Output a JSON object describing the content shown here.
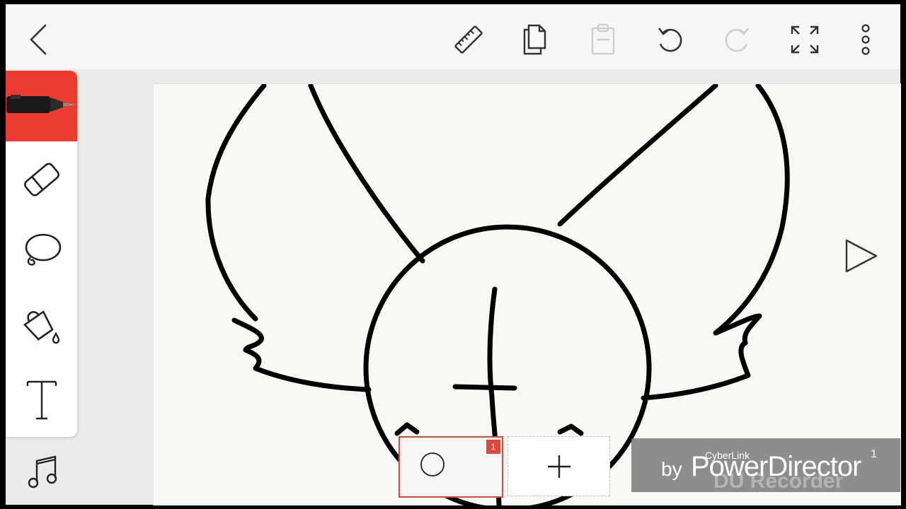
{
  "toolbar": {
    "back_icon": "chevron-left-icon",
    "ruler_icon": "ruler-icon",
    "copy_icon": "copy-pages-icon",
    "paste_icon": "clipboard-icon",
    "undo_icon": "undo-icon",
    "redo_icon": "redo-icon",
    "fullscreen_icon": "expand-icon",
    "more_icon": "more-vertical-icon"
  },
  "tools": [
    {
      "name": "pen",
      "icon": "pen-icon",
      "active": true
    },
    {
      "name": "eraser",
      "icon": "eraser-icon",
      "active": false
    },
    {
      "name": "lasso",
      "icon": "lasso-icon",
      "active": false
    },
    {
      "name": "fill",
      "icon": "paint-bucket-icon",
      "active": false
    },
    {
      "name": "text",
      "icon": "text-tool-icon",
      "active": false
    }
  ],
  "timeline": {
    "frame_number": "1",
    "add_icon": "plus-icon"
  },
  "watermark": {
    "brand_small": "CyberLink",
    "by": "by",
    "product": "PowerDirector",
    "recorder": "DU Recorder",
    "corner": "1"
  },
  "colors": {
    "accent": "#ea3c2f",
    "ink": "#000000",
    "paper": "#f9f8f5"
  }
}
